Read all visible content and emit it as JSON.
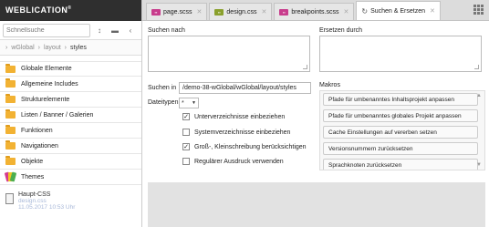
{
  "app": {
    "brand": "WEBLICATION",
    "brand_mark": "®"
  },
  "sidebar": {
    "search_placeholder": "Schnellsuche",
    "breadcrumb": [
      "wGlobal",
      "layout",
      "styles"
    ],
    "items": [
      {
        "label": "Globale Elemente",
        "icon": "folder-icon"
      },
      {
        "label": "Allgemeine Includes",
        "icon": "folder-icon"
      },
      {
        "label": "Strukturelemente",
        "icon": "folder-icon"
      },
      {
        "label": "Listen / Banner / Galerien",
        "icon": "folder-icon"
      },
      {
        "label": "Funktionen",
        "icon": "folder-icon"
      },
      {
        "label": "Navigationen",
        "icon": "folder-icon"
      },
      {
        "label": "Objekte",
        "icon": "folder-icon"
      },
      {
        "label": "Themes",
        "icon": "themes-icon"
      }
    ],
    "file": {
      "title": "Haupt-CSS",
      "name": "design.css",
      "date": "11.05.2017 10:53 Uhr"
    }
  },
  "tabs": [
    {
      "label": "page.scss",
      "icon": "scss-file-icon",
      "color": "#c83c8c"
    },
    {
      "label": "design.css",
      "icon": "css-file-icon",
      "color": "#8aa02c"
    },
    {
      "label": "breakpoints.scss",
      "icon": "scss-file-icon",
      "color": "#c83c8c"
    },
    {
      "label": "Suchen & Ersetzen",
      "icon": "search-replace-icon",
      "active": true
    }
  ],
  "main": {
    "search_label": "Suchen nach",
    "replace_label": "Ersetzen durch",
    "search_in_label": "Suchen in",
    "search_in_value": "/demo-38-wGlobal/wGlobal/layout/styles",
    "filetypes_label": "Dateitypen",
    "filetypes_value": "*",
    "options": [
      {
        "label": "Unterverzeichnisse einbeziehen",
        "checked": true
      },
      {
        "label": "Systemverzeichnisse einbeziehen",
        "checked": false
      },
      {
        "label": "Groß-, Kleinschreibung berücksichtigen",
        "checked": true
      },
      {
        "label": "Regulärer Ausdruck verwenden",
        "checked": false
      }
    ],
    "macros_label": "Makros",
    "macros": [
      "Pfade für umbenanntes Inhaltsprojekt anpassen",
      "Pfade für umbenanntes globales Projekt anpassen",
      "Cache Einstellungen auf vererben setzen",
      "Versionsnummern zurücksetzen",
      "Sprachknoten zurücksetzen"
    ]
  }
}
